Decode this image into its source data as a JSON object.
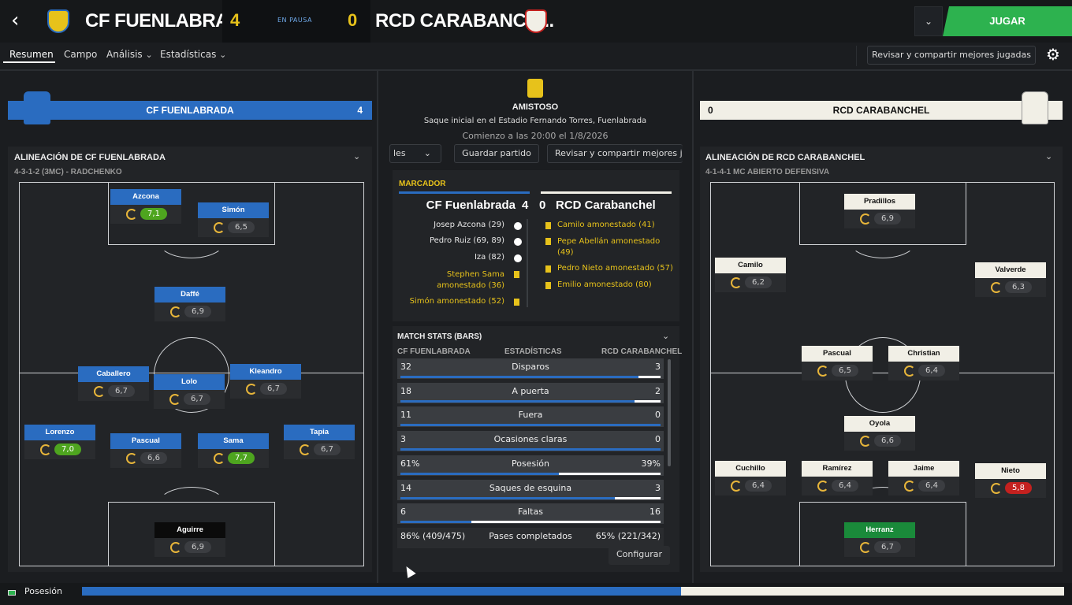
{
  "header": {
    "home_team": "CF FUENLABRADA",
    "home_score": "4",
    "status": "EN PAUSA",
    "away_score": "0",
    "away_team": "RCD CARABANCH...",
    "play_label": "JUGAR",
    "dropdown_icon": "chevron-down-icon",
    "colors": {
      "accent_green": "#2db24f",
      "score_yellow": "#e7c21b",
      "home_blue": "#2a6cc0"
    }
  },
  "tabs": [
    {
      "label": "Resumen",
      "active": true
    },
    {
      "label": "Campo"
    },
    {
      "label": "Análisis"
    },
    {
      "label": "Estadísticas"
    }
  ],
  "share_label": "Revisar y compartir mejores jugadas",
  "home": {
    "name": "CF FUENLABRADA",
    "score": "4",
    "lineup_title": "ALINEACIÓN DE CF FUENLABRADA",
    "formation": "4-3-1-2 (3MC) - RADCHENKO",
    "players": [
      {
        "name": "Azcona",
        "rating": "7,1",
        "tone": "good"
      },
      {
        "name": "Simón",
        "rating": "6,5",
        "tone": ""
      },
      {
        "name": "Daffé",
        "rating": "6,9",
        "tone": ""
      },
      {
        "name": "Caballero",
        "rating": "6,7",
        "tone": ""
      },
      {
        "name": "Kleandro",
        "rating": "6,7",
        "tone": ""
      },
      {
        "name": "Lolo",
        "rating": "6,7",
        "tone": ""
      },
      {
        "name": "Lorenzo",
        "rating": "7,0",
        "tone": "good"
      },
      {
        "name": "Pascual",
        "rating": "6,6",
        "tone": ""
      },
      {
        "name": "Sama",
        "rating": "7,7",
        "tone": "good"
      },
      {
        "name": "Tapia",
        "rating": "6,7",
        "tone": ""
      },
      {
        "name": "Aguirre",
        "rating": "6,9",
        "tone": ""
      }
    ]
  },
  "away": {
    "name": "RCD CARABANCHEL",
    "score": "0",
    "lineup_title": "ALINEACIÓN DE RCD CARABANCHEL",
    "formation": "4-1-4-1 MC ABIERTO DEFENSIVA",
    "players": [
      {
        "name": "Pradillos",
        "rating": "6,9",
        "tone": ""
      },
      {
        "name": "Camilo",
        "rating": "6,2",
        "tone": ""
      },
      {
        "name": "Valverde",
        "rating": "6,3",
        "tone": ""
      },
      {
        "name": "Pascual",
        "rating": "6,5",
        "tone": ""
      },
      {
        "name": "Christian",
        "rating": "6,4",
        "tone": ""
      },
      {
        "name": "Oyola",
        "rating": "6,6",
        "tone": ""
      },
      {
        "name": "Cuchillo",
        "rating": "6,4",
        "tone": ""
      },
      {
        "name": "Ramírez",
        "rating": "6,4",
        "tone": ""
      },
      {
        "name": "Jaime",
        "rating": "6,4",
        "tone": ""
      },
      {
        "name": "Nieto",
        "rating": "5,8",
        "tone": "bad"
      },
      {
        "name": "Herranz",
        "rating": "6,7",
        "tone": ""
      }
    ]
  },
  "match": {
    "competition": "AMISTOSO",
    "venue": "Saque inicial en el Estadio Fernando Torres, Fuenlabrada",
    "kickoff": "Comienzo a las 20:00 el 1/8/2026",
    "dropdown_partial": "les",
    "save_label": "Guardar partido",
    "share_partial": "Revisar y compartir mejores ju"
  },
  "scoreboard": {
    "title": "MARCADOR",
    "home": "CF Fuenlabrada",
    "home_score": "4",
    "away_score": "0",
    "away": "RCD Carabanchel",
    "home_events": [
      {
        "text": "Josep Azcona (29)",
        "type": "goal"
      },
      {
        "text": "Pedro Ruiz (69, 89)",
        "type": "goal"
      },
      {
        "text": "Iza (82)",
        "type": "goal"
      },
      {
        "text": "Stephen Sama amonestado (36)",
        "type": "yellow"
      },
      {
        "text": "Simón amonestado (52)",
        "type": "yellow"
      }
    ],
    "away_events": [
      {
        "text": "Camilo amonestado (41)",
        "type": "yellow"
      },
      {
        "text": "Pepe Abellán amonestado (49)",
        "type": "yellow"
      },
      {
        "text": "Pedro Nieto amonestado (57)",
        "type": "yellow"
      },
      {
        "text": "Emilio amonestado (80)",
        "type": "yellow"
      }
    ]
  },
  "stats": {
    "title": "MATCH STATS (BARS)",
    "col_home": "CF FUENLABRADA",
    "col_mid": "ESTADÍSTICAS",
    "col_away": "RCD CARABANCHEL",
    "rows": [
      {
        "label": "Disparos",
        "home": "32",
        "away": "3",
        "home_frac": 0.914
      },
      {
        "label": "A puerta",
        "home": "18",
        "away": "2",
        "home_frac": 0.9
      },
      {
        "label": "Fuera",
        "home": "11",
        "away": "0",
        "home_frac": 1.0
      },
      {
        "label": "Ocasiones claras",
        "home": "3",
        "away": "0",
        "home_frac": 1.0
      },
      {
        "label": "Posesión",
        "home": "61%",
        "away": "39%",
        "home_frac": 0.61
      },
      {
        "label": "Saques de esquina",
        "home": "14",
        "away": "3",
        "home_frac": 0.824
      },
      {
        "label": "Faltas",
        "home": "6",
        "away": "16",
        "home_frac": 0.273
      },
      {
        "label": "Pases completados",
        "home": "86% (409/475)",
        "away": "65% (221/342)",
        "home_frac": null
      }
    ],
    "config_label": "Configurar"
  },
  "footer": {
    "label": "Posesión",
    "home_possession": 0.61
  }
}
